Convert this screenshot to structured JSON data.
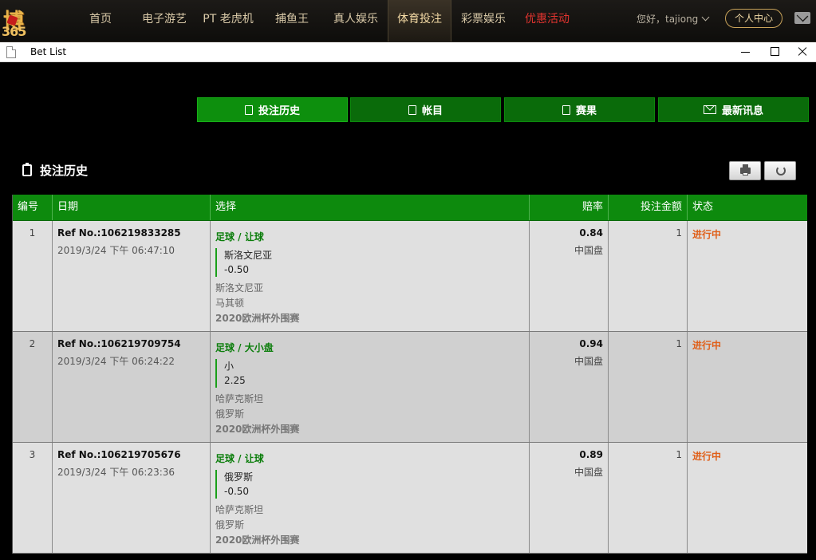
{
  "logo": {
    "text": "博",
    "num": "365"
  },
  "nav": {
    "items": [
      "首页",
      "电子游艺",
      "PT 老虎机",
      "捕鱼王",
      "真人娱乐",
      "体育投注",
      "彩票娱乐",
      "优惠活动"
    ],
    "greeting": "您好，tajiong",
    "user_center": "个人中心"
  },
  "window": {
    "title": "Bet List"
  },
  "tabs": [
    "投注历史",
    "帐目",
    "赛果",
    "最新讯息"
  ],
  "section": {
    "title": "投注历史"
  },
  "table": {
    "headers": [
      "编号",
      "日期",
      "选择",
      "赔率",
      "投注金额",
      "状态"
    ],
    "rows": [
      {
        "no": "1",
        "ref": "Ref No.:106219833285",
        "date": "2019/3/24 下午 06:47:10",
        "sport": "足球 / 让球",
        "pick": "斯洛文尼亚",
        "line": "-0.50",
        "home": "斯洛文尼亚",
        "away": "马其顿",
        "league": "2020欧洲杯外围赛",
        "odds": "0.84",
        "odds_type": "中国盘",
        "stake": "1",
        "status": "进行中"
      },
      {
        "no": "2",
        "ref": "Ref No.:106219709754",
        "date": "2019/3/24 下午 06:24:22",
        "sport": "足球 / 大小盘",
        "pick": "小",
        "line": "2.25",
        "home": "哈萨克斯坦",
        "away": "俄罗斯",
        "league": "2020欧洲杯外围赛",
        "odds": "0.94",
        "odds_type": "中国盘",
        "stake": "1",
        "status": "进行中"
      },
      {
        "no": "3",
        "ref": "Ref No.:106219705676",
        "date": "2019/3/24 下午 06:23:36",
        "sport": "足球 / 让球",
        "pick": "俄罗斯",
        "line": "-0.50",
        "home": "哈萨克斯坦",
        "away": "俄罗斯",
        "league": "2020欧洲杯外围赛",
        "odds": "0.89",
        "odds_type": "中国盘",
        "stake": "1",
        "status": "进行中"
      }
    ]
  }
}
